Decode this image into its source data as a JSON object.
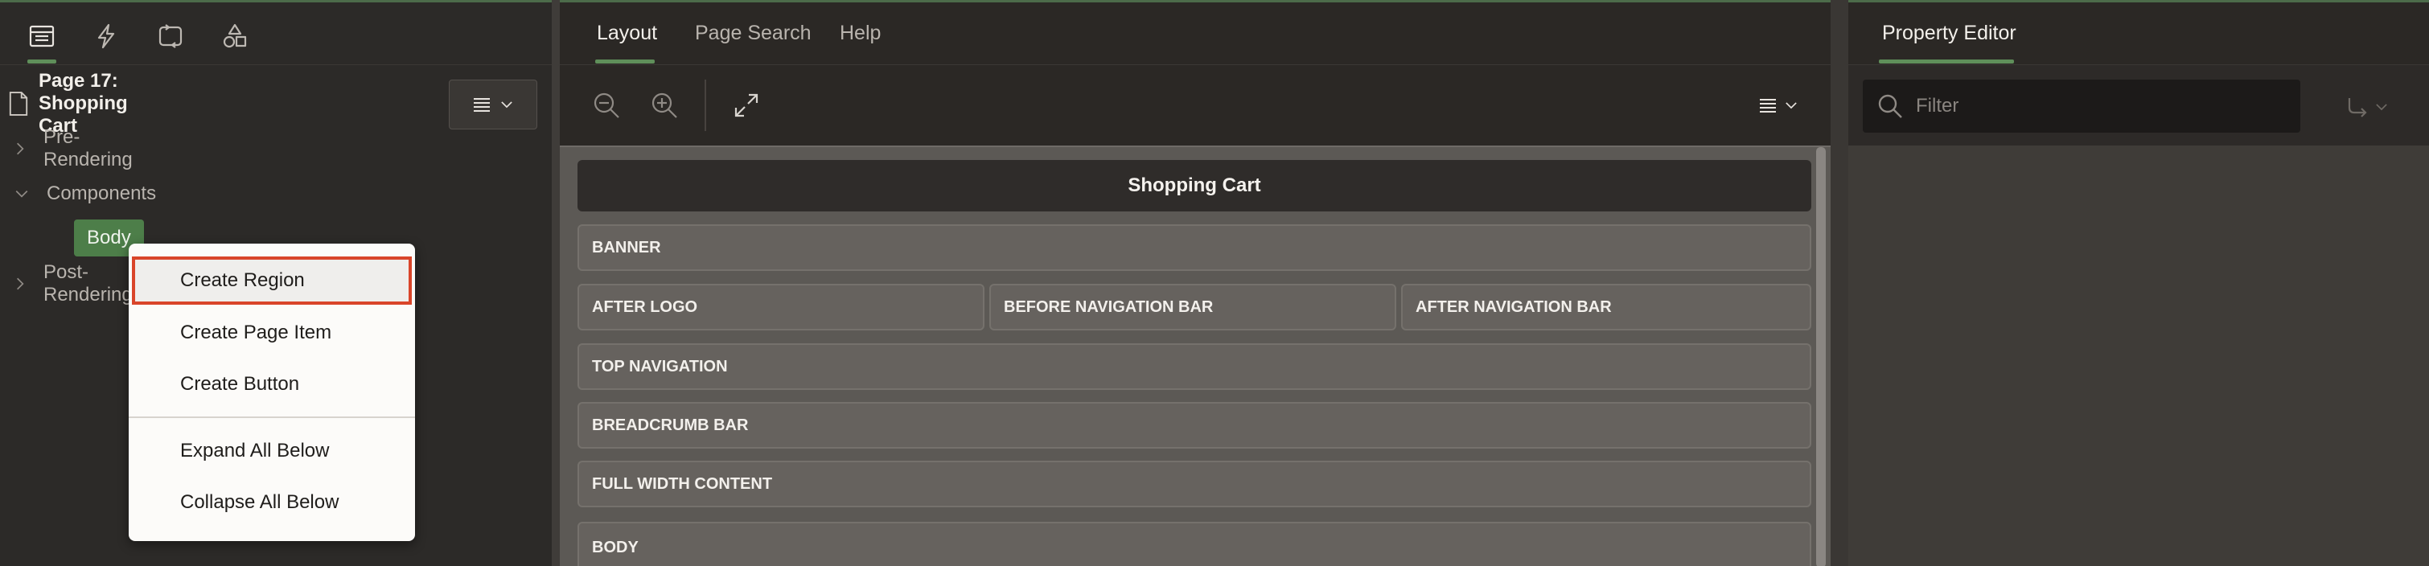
{
  "left_panel": {
    "tabs": [
      {
        "name": "rendering",
        "icon": "rendering-tree-icon",
        "active": true
      },
      {
        "name": "dynamic-actions",
        "icon": "lightning-icon",
        "active": false
      },
      {
        "name": "processing",
        "icon": "processing-cycle-icon",
        "active": false
      },
      {
        "name": "shared-components",
        "icon": "shapes-icon",
        "active": false
      }
    ],
    "tree_menu_icon": "menu-lines-icon",
    "tree": {
      "page_title": "Page 17: Shopping Cart",
      "nodes": {
        "pre_rendering": "Pre-Rendering",
        "components": "Components",
        "body": "Body",
        "post_rendering": "Post-Rendering"
      }
    },
    "context_menu": {
      "items": [
        {
          "label": "Create Region",
          "focused": true
        },
        {
          "label": "Create Page Item"
        },
        {
          "label": "Create Button"
        },
        {
          "label": "Expand All Below"
        },
        {
          "label": "Collapse All Below"
        }
      ]
    }
  },
  "middle_panel": {
    "tabs": [
      {
        "label": "Layout",
        "active": true
      },
      {
        "label": "Page Search",
        "active": false
      },
      {
        "label": "Help",
        "active": false
      }
    ],
    "toolbar": {
      "icons": [
        "zoom-out-icon",
        "zoom-in-icon",
        "expand-icon",
        "menu-lines-icon"
      ]
    },
    "canvas": {
      "page_header": "Shopping Cart",
      "slots": {
        "banner": "BANNER",
        "after_logo": "AFTER LOGO",
        "before_navigation_bar": "BEFORE NAVIGATION BAR",
        "after_navigation_bar": "AFTER NAVIGATION BAR",
        "top_navigation": "TOP NAVIGATION",
        "breadcrumb_bar": "BREADCRUMB BAR",
        "full_width_content": "FULL WIDTH CONTENT",
        "body": "BODY"
      }
    }
  },
  "right_panel": {
    "tabs": [
      {
        "label": "Property Editor",
        "active": true
      }
    ],
    "filter": {
      "placeholder": "Filter",
      "value": ""
    },
    "goto_icon": "go-to-group-icon"
  },
  "colors": {
    "accent_green": "#5f8f5a",
    "body_badge": "#4d7e49",
    "focus_outline": "#d9452a",
    "canvas_bg": "#5c5955"
  }
}
